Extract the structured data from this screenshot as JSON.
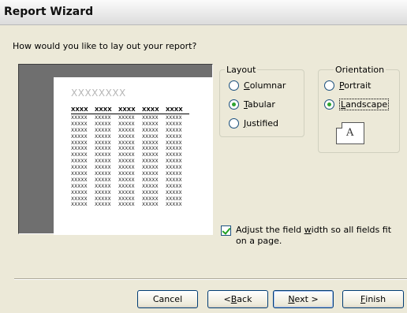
{
  "window": {
    "title": "Report Wizard"
  },
  "prompt": "How would you like to lay out your report?",
  "preview": {
    "title": "XXXXXXXX",
    "headers": [
      "XXXX",
      "XXXX",
      "XXXX",
      "XXXX",
      "XXXX"
    ],
    "cell": "XXXXX",
    "row_count": 15
  },
  "layout": {
    "legend": "Layout",
    "options": [
      {
        "accel": "C",
        "rest": "olumnar",
        "checked": false
      },
      {
        "accel": "T",
        "rest": "abular",
        "checked": true
      },
      {
        "accel": "J",
        "rest": "ustified",
        "checked": false
      }
    ]
  },
  "orientation": {
    "legend": "Orientation",
    "options": [
      {
        "accel": "P",
        "rest": "ortrait",
        "checked": false
      },
      {
        "accel": "L",
        "rest": "andscape",
        "checked": true
      }
    ],
    "preview_letter": "A"
  },
  "adjust": {
    "checked": true,
    "pre": "Adjust the field ",
    "accel": "w",
    "post": "idth so all fields fit on a page."
  },
  "buttons": {
    "cancel": "Cancel",
    "back_pre": "< ",
    "back_accel": "B",
    "back_post": "ack",
    "next_accel": "N",
    "next_post": "ext >",
    "finish_accel": "F",
    "finish_post": "inish"
  }
}
